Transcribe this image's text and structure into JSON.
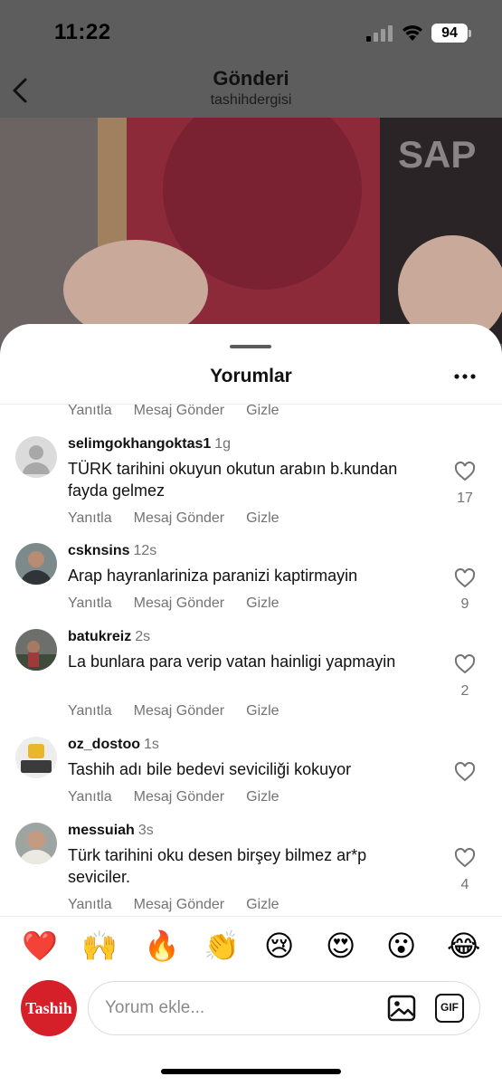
{
  "status_bar": {
    "time": "11:22",
    "battery": "94"
  },
  "header": {
    "title": "Gönderi",
    "subtitle": "tashihdergisi"
  },
  "post_image": {
    "description_icon": "book-cover-image"
  },
  "comments_sheet": {
    "title": "Yorumlar",
    "action_labels": {
      "reply": "Yanıtla",
      "message": "Mesaj Gönder",
      "hide": "Gizle"
    },
    "comments": [
      {
        "username": "selimgokhangoktas1",
        "time": "1g",
        "text": "TÜRK tarihini okuyun okutun arabın b.kundan fayda gelmez",
        "likes": "17"
      },
      {
        "username": "csknsins",
        "time": "12s",
        "text": "Arap hayranlariniza paranizi kaptirmayin",
        "likes": "9"
      },
      {
        "username": "batukreiz",
        "time": "2s",
        "text": "La bunlara para verip vatan hainligi yapmayin",
        "likes": "2"
      },
      {
        "username": "oz_dostoo",
        "time": "1s",
        "text": "Tashih adı bile bedevi seviciliği kokuyor",
        "likes": ""
      },
      {
        "username": "messuiah",
        "time": "3s",
        "text": "Türk tarihini oku desen birşey bilmez ar*p seviciler.",
        "likes": "4"
      }
    ]
  },
  "emoji_bar": [
    "❤️",
    "🙌",
    "🔥",
    "👏",
    "😢",
    "😍",
    "😮",
    "😂"
  ],
  "composer": {
    "avatar_label": "Tashih",
    "placeholder": "Yorum ekle...",
    "gif_label": "GIF"
  }
}
